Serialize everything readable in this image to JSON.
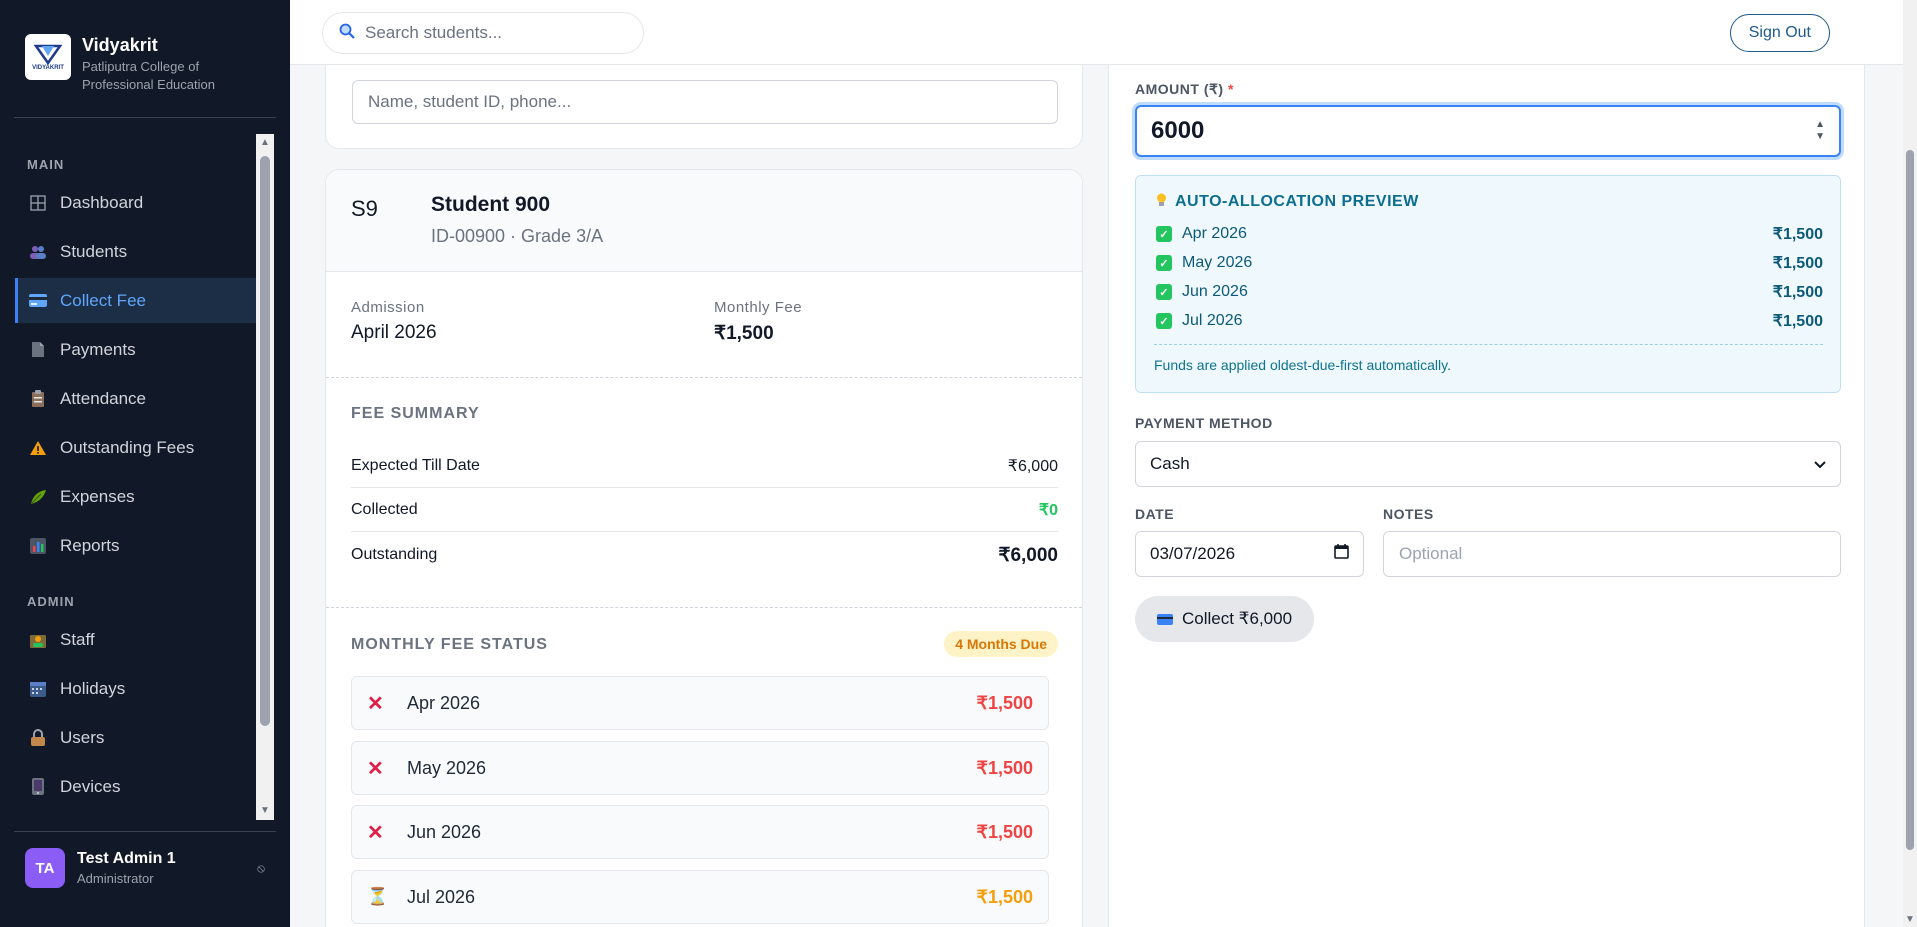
{
  "brand": {
    "name": "Vidyakrit",
    "logo_text": "VIDYAKRIT",
    "subtitle": "Patliputra College of Professional Education"
  },
  "sidebar": {
    "main_label": "MAIN",
    "admin_label": "ADMIN",
    "main_items": [
      {
        "label": "Dashboard",
        "icon": "grid-icon"
      },
      {
        "label": "Students",
        "icon": "people-icon"
      },
      {
        "label": "Collect Fee",
        "icon": "credit-card-icon",
        "active": true
      },
      {
        "label": "Payments",
        "icon": "document-icon"
      },
      {
        "label": "Attendance",
        "icon": "clipboard-icon"
      },
      {
        "label": "Outstanding Fees",
        "icon": "warning-icon"
      },
      {
        "label": "Expenses",
        "icon": "leaf-icon"
      },
      {
        "label": "Reports",
        "icon": "bar-chart-icon"
      }
    ],
    "admin_items": [
      {
        "label": "Staff",
        "icon": "staff-icon"
      },
      {
        "label": "Holidays",
        "icon": "calendar-icon"
      },
      {
        "label": "Users",
        "icon": "lock-icon"
      },
      {
        "label": "Devices",
        "icon": "device-icon"
      }
    ],
    "user": {
      "initials": "TA",
      "name": "Test Admin 1",
      "role": "Administrator",
      "action_icon": "⦸"
    }
  },
  "topbar": {
    "search_placeholder": "Search students...",
    "signout_label": "Sign Out"
  },
  "student_search": {
    "placeholder": "Name, student ID, phone..."
  },
  "student": {
    "initials": "S9",
    "name": "Student 900",
    "id_line": "ID-00900 · Grade 3/A",
    "admission_label": "Admission",
    "admission_value": "April 2026",
    "monthly_fee_label": "Monthly Fee",
    "monthly_fee_value": "₹1,500"
  },
  "fee_summary": {
    "title": "FEE SUMMARY",
    "rows": [
      {
        "label": "Expected Till Date",
        "value": "₹6,000"
      },
      {
        "label": "Collected",
        "value": "₹0"
      },
      {
        "label": "Outstanding",
        "value": "₹6,000"
      }
    ]
  },
  "monthly_status": {
    "title": "MONTHLY FEE STATUS",
    "badge": "4 Months Due",
    "rows": [
      {
        "icon": "✕",
        "month": "Apr 2026",
        "amount": "₹1,500",
        "status": "overdue"
      },
      {
        "icon": "✕",
        "month": "May 2026",
        "amount": "₹1,500",
        "status": "overdue"
      },
      {
        "icon": "✕",
        "month": "Jun 2026",
        "amount": "₹1,500",
        "status": "overdue"
      },
      {
        "icon": "⏳",
        "month": "Jul 2026",
        "amount": "₹1,500",
        "status": "pending"
      }
    ]
  },
  "payment_form": {
    "amount_label": "AMOUNT (₹)",
    "required_mark": "*",
    "amount_value": "6000",
    "preview": {
      "title": "AUTO-ALLOCATION PREVIEW",
      "rows": [
        {
          "month": "Apr 2026",
          "amount": "₹1,500"
        },
        {
          "month": "May 2026",
          "amount": "₹1,500"
        },
        {
          "month": "Jun 2026",
          "amount": "₹1,500"
        },
        {
          "month": "Jul 2026",
          "amount": "₹1,500"
        }
      ],
      "note": "Funds are applied oldest-due-first automatically."
    },
    "method_label": "PAYMENT METHOD",
    "method_value": "Cash",
    "date_label": "DATE",
    "date_value": "03/07/2026",
    "notes_label": "NOTES",
    "notes_placeholder": "Optional",
    "collect_label": "Collect ₹6,000"
  },
  "colors": {
    "sidebar_bg": "#111827",
    "accent": "#3b82f6",
    "overdue": "#ef4444",
    "pending": "#f59e0b",
    "collected": "#22c55e"
  }
}
